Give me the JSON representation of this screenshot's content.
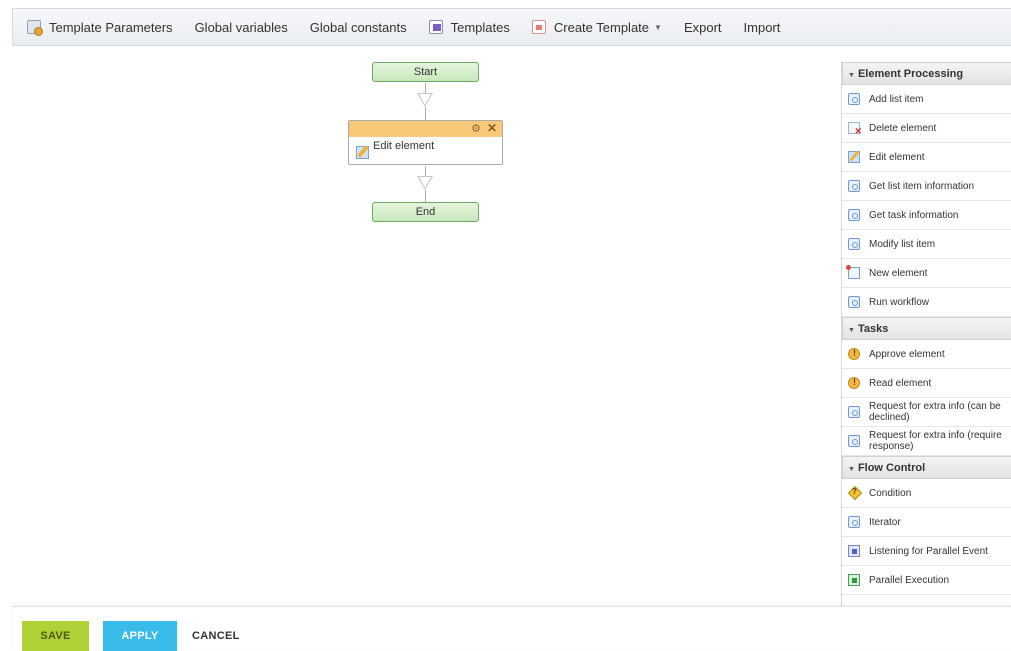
{
  "toolbar": {
    "template_parameters": "Template Parameters",
    "global_variables": "Global variables",
    "global_constants": "Global constants",
    "templates": "Templates",
    "create_template": "Create Template",
    "export": "Export",
    "import": "Import"
  },
  "canvas": {
    "start_label": "Start",
    "end_label": "End",
    "action": {
      "label": "Edit element",
      "icon": "edit-element-icon"
    }
  },
  "panel": {
    "element_processing": {
      "title": "Element Processing",
      "items": [
        {
          "label": "Add list item",
          "icon": "action-box-icon"
        },
        {
          "label": "Delete element",
          "icon": "delete-element-icon"
        },
        {
          "label": "Edit element",
          "icon": "edit-element-icon"
        },
        {
          "label": "Get list item information",
          "icon": "action-box-icon"
        },
        {
          "label": "Get task information",
          "icon": "action-box-icon"
        },
        {
          "label": "Modify list item",
          "icon": "action-box-icon"
        },
        {
          "label": "New element",
          "icon": "new-element-icon"
        },
        {
          "label": "Run workflow",
          "icon": "action-box-icon"
        }
      ]
    },
    "tasks": {
      "title": "Tasks",
      "items": [
        {
          "label": "Approve element",
          "icon": "approve-icon"
        },
        {
          "label": "Read element",
          "icon": "approve-icon"
        },
        {
          "label": "Request for extra info (can be declined)",
          "icon": "action-box-icon"
        },
        {
          "label": "Request for extra info (require response)",
          "icon": "action-box-icon"
        }
      ]
    },
    "flow_control": {
      "title": "Flow Control",
      "items": [
        {
          "label": "Condition",
          "icon": "condition-icon"
        },
        {
          "label": "Iterator",
          "icon": "action-box-icon"
        },
        {
          "label": "Listening for Parallel Event",
          "icon": "listen-icon"
        },
        {
          "label": "Parallel Execution",
          "icon": "parallel-icon"
        }
      ]
    }
  },
  "footer": {
    "save_label": "SAVE",
    "apply_label": "APPLY",
    "cancel_label": "CANCEL"
  },
  "colors": {
    "node_fill": "#c9e8bd",
    "action_header": "#f9c97a",
    "save_button": "#b1d236",
    "apply_button": "#39bbea"
  }
}
